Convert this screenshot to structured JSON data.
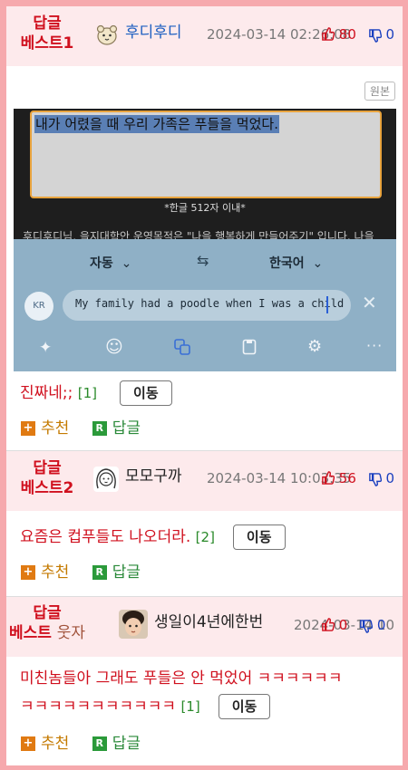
{
  "comments": [
    {
      "best_label_1": "답글",
      "best_label_2": "베스트1",
      "nickname": "후디후디",
      "date": "2024-03-14 02:26:08",
      "up": "80",
      "down": "0",
      "text": "진짜네;;",
      "reply_count": "[1]",
      "move_label": "이동",
      "recommend_label": "추천",
      "reply_label": "답글"
    },
    {
      "best_label_1": "답글",
      "best_label_2": "베스트2",
      "nickname": "모모구까",
      "date": "2024-03-14 10:03:35",
      "up": "56",
      "down": "0",
      "text": "요즘은 컵푸들도 나오더라.",
      "reply_count": "[2]",
      "move_label": "이동",
      "recommend_label": "추천",
      "reply_label": "답글"
    },
    {
      "best_label_1": "답글",
      "best_label_2": "베스트",
      "best_label_sub": "웃자",
      "nickname": "생일이4년에한번",
      "date": "2024-03-14 10:2",
      "up": "0",
      "down": "0",
      "text_line1": "미친놈들아 그래도 푸들은 안 먹었어 ㅋㅋㅋㅋㅋㅋ",
      "text_line2": "ㅋㅋㅋㅋㅋㅋㅋㅋㅋㅋㅋ",
      "reply_count": "[1]",
      "move_label": "이동",
      "recommend_label": "추천",
      "reply_label": "답글"
    }
  ],
  "original_button": "원본",
  "screenshot": {
    "korean_text": "내가 어렸을 때 우리 가족은 푸들을 먹었다.",
    "limit": "*한글 512자 이내*",
    "behind_text": "후디후디님, 을지대학안 운영목적은 \"나을 행복하게 만들어주기\" 입니다. 나을",
    "source_lang": "자동",
    "target_lang": "한국어",
    "kr_badge": "KR",
    "translation": "My family had a poodle when I was a child",
    "accent": "#e8a33d",
    "panel_bg": "#8fb0c6"
  }
}
